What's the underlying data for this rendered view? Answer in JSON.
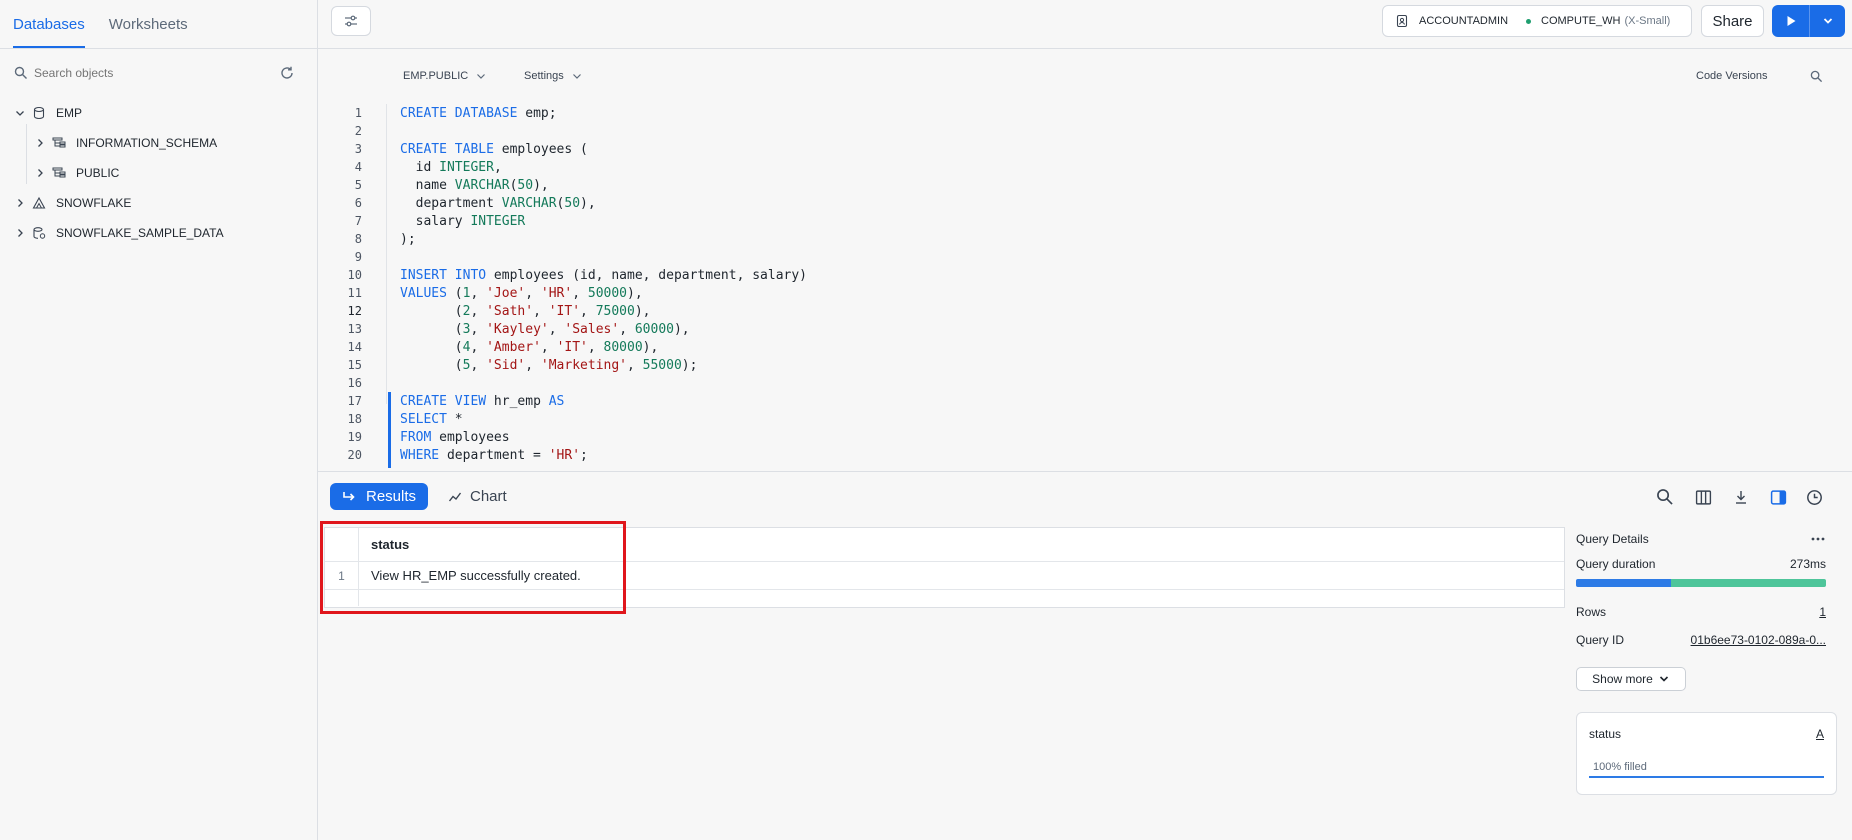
{
  "sidebar": {
    "tabs": [
      {
        "label": "Databases",
        "active": true
      },
      {
        "label": "Worksheets",
        "active": false
      }
    ],
    "search_placeholder": "Search objects",
    "tree": [
      {
        "label": "EMP",
        "expanded": true,
        "level": 0,
        "icon": "database-icon"
      },
      {
        "label": "INFORMATION_SCHEMA",
        "expanded": false,
        "level": 1,
        "icon": "schema-icon"
      },
      {
        "label": "PUBLIC",
        "expanded": false,
        "level": 1,
        "icon": "schema-icon"
      },
      {
        "label": "SNOWFLAKE",
        "expanded": false,
        "level": 0,
        "icon": "snowflake-app-icon"
      },
      {
        "label": "SNOWFLAKE_SAMPLE_DATA",
        "expanded": false,
        "level": 0,
        "icon": "shared-database-icon"
      }
    ]
  },
  "topbar": {
    "role": "ACCOUNTADMIN",
    "warehouse": "COMPUTE_WH",
    "warehouse_size": "(X-Small)",
    "share_label": "Share"
  },
  "editor": {
    "context": "EMP.PUBLIC",
    "settings_label": "Settings",
    "code_versions_label": "Code Versions",
    "current_line": 12,
    "lines": [
      "CREATE DATABASE emp;",
      "",
      "CREATE TABLE employees (",
      "  id INTEGER,",
      "  name VARCHAR(50),",
      "  department VARCHAR(50),",
      "  salary INTEGER",
      ");",
      "",
      "INSERT INTO employees (id, name, department, salary)",
      "VALUES (1, 'Joe', 'HR', 50000),",
      "       (2, 'Sath', 'IT', 75000),",
      "       (3, 'Kayley', 'Sales', 60000),",
      "       (4, 'Amber', 'IT', 80000),",
      "       (5, 'Sid', 'Marketing', 55000);",
      "",
      "CREATE VIEW hr_emp AS",
      "SELECT *",
      "FROM employees",
      "WHERE department = 'HR';"
    ]
  },
  "results": {
    "results_label": "Results",
    "chart_label": "Chart",
    "columns": [
      "status"
    ],
    "rows": [
      {
        "num": "1",
        "cells": [
          "View HR_EMP successfully created."
        ]
      }
    ]
  },
  "query_details": {
    "title": "Query Details",
    "duration_label": "Query duration",
    "duration_value": "273ms",
    "rows_label": "Rows",
    "rows_value": "1",
    "query_id_label": "Query ID",
    "query_id_value": "01b6ee73-0102-089a-0...",
    "show_more_label": "Show more",
    "column_card": {
      "name": "status",
      "type_glyph": "A",
      "fill_label": "100% filled",
      "fill_fraction": 1.0
    }
  },
  "colors": {
    "accent": "#1a6ce7",
    "highlight": "#e0161c",
    "duration_compile": "#2d7be6",
    "duration_exec": "#4ec59a"
  }
}
